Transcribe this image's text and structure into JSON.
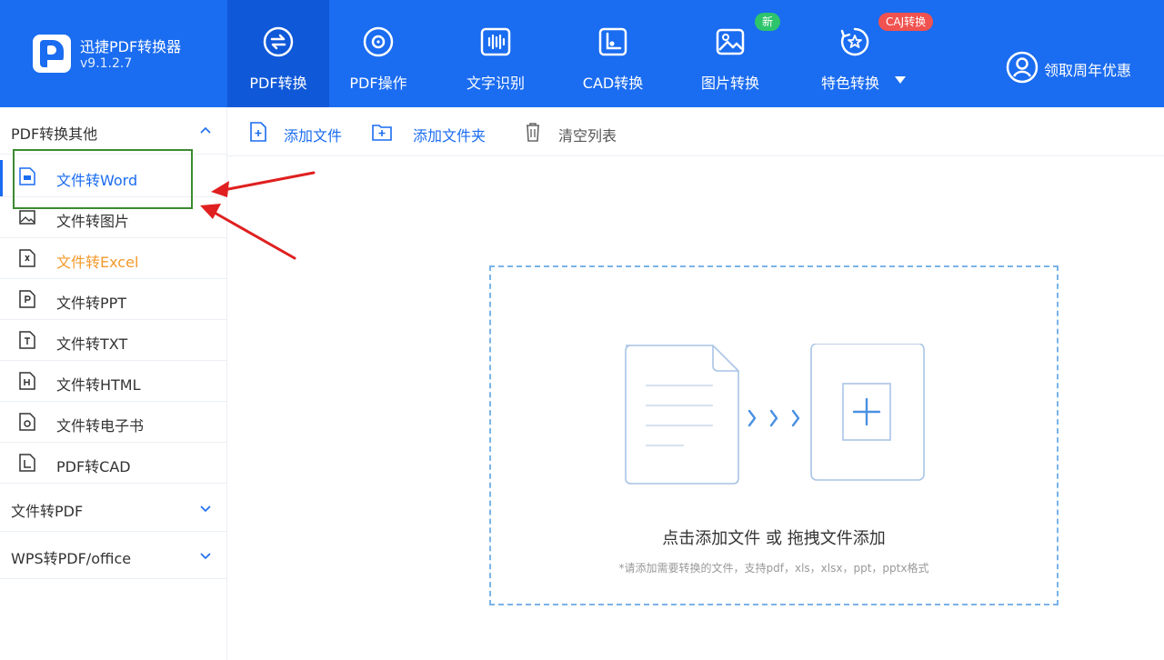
{
  "app": {
    "name": "迅捷PDF转换器",
    "version": "v9.1.2.7"
  },
  "nav": {
    "tabs": [
      {
        "label": "PDF转换",
        "icon": "pdf-convert-icon",
        "active": true
      },
      {
        "label": "PDF操作",
        "icon": "pdf-operate-icon"
      },
      {
        "label": "文字识别",
        "icon": "ocr-icon"
      },
      {
        "label": "CAD转换",
        "icon": "cad-icon"
      },
      {
        "label": "图片转换",
        "icon": "image-icon",
        "badge": "新"
      },
      {
        "label": "特色转换",
        "icon": "special-icon",
        "badge": "CAJ转换"
      }
    ],
    "right_label": "领取周年优惠"
  },
  "sidebar": {
    "sections": [
      {
        "title": "PDF转换其他",
        "expanded": true
      },
      {
        "title": "文件转PDF",
        "expanded": false
      },
      {
        "title": "WPS转PDF/office",
        "expanded": false
      }
    ],
    "items": [
      {
        "label": "文件转Word",
        "icon": "word-file-icon",
        "active": true
      },
      {
        "label": "文件转图片",
        "icon": "image-file-icon"
      },
      {
        "label": "文件转Excel",
        "icon": "excel-file-icon"
      },
      {
        "label": "文件转PPT",
        "icon": "ppt-file-icon"
      },
      {
        "label": "文件转TXT",
        "icon": "txt-file-icon"
      },
      {
        "label": "文件转HTML",
        "icon": "html-file-icon"
      },
      {
        "label": "文件转电子书",
        "icon": "ebook-file-icon"
      },
      {
        "label": "PDF转CAD",
        "icon": "cad-file-icon"
      }
    ]
  },
  "toolbar": {
    "add_file": "添加文件",
    "add_folder": "添加文件夹",
    "clear_list": "清空列表"
  },
  "dropzone": {
    "main": "点击添加文件 或 拖拽文件添加",
    "sub": "*请添加需要转换的文件，支持pdf，xls，xlsx，ppt，pptx格式"
  },
  "colors": {
    "header": "#1a6cf0",
    "active_tab": "#0f58d8",
    "accent": "#1a6cf0",
    "excel_label": "#f39a2b",
    "annotation_arrow": "#e02020",
    "annotation_box": "#3d8a31"
  }
}
